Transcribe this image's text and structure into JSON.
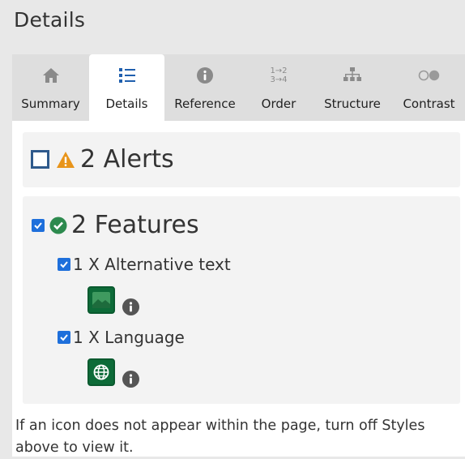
{
  "header": {
    "title": "Details"
  },
  "tabs": [
    {
      "label": "Summary",
      "icon": "home-icon"
    },
    {
      "label": "Details",
      "icon": "list-icon"
    },
    {
      "label": "Reference",
      "icon": "info-icon"
    },
    {
      "label": "Order",
      "icon": "order-icon",
      "glyph_top": "1→2",
      "glyph_bottom": "3→4"
    },
    {
      "label": "Structure",
      "icon": "structure-icon"
    },
    {
      "label": "Contrast",
      "icon": "contrast-icon"
    }
  ],
  "alerts": {
    "label": "2 Alerts",
    "checked": false
  },
  "features": {
    "label": "2 Features",
    "checked": true,
    "items": [
      {
        "label": "1 X Alternative text",
        "checked": true,
        "icon": "image-icon"
      },
      {
        "label": "1 X Language",
        "checked": true,
        "icon": "globe-icon"
      }
    ]
  },
  "footer_note": "If an icon does not appear within the page, turn off Styles above to view it.",
  "colors": {
    "accent_blue": "#1e6fdb",
    "alert_orange": "#e8941a",
    "success_green": "#2d8a4e",
    "tile_green": "#0d6b38"
  }
}
